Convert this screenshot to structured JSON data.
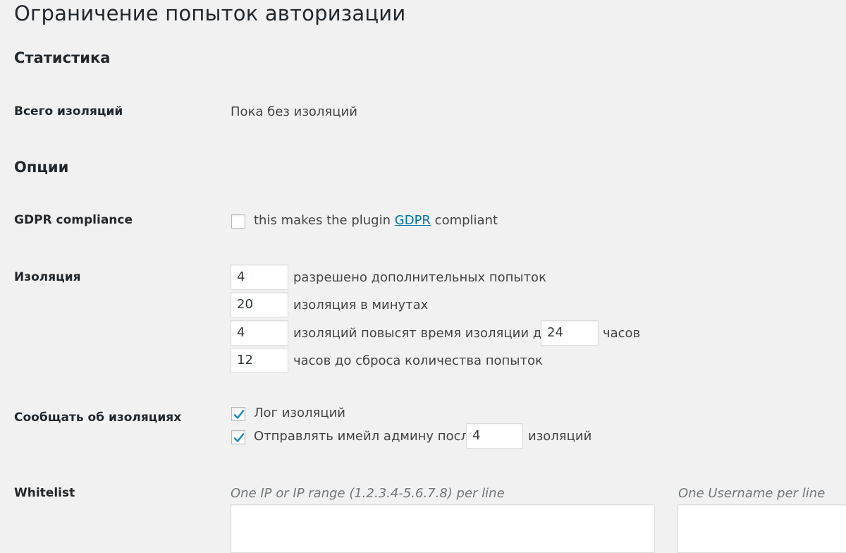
{
  "page": {
    "title": "Ограничение попыток авторизации"
  },
  "statistics": {
    "heading": "Статистика",
    "total_label": "Всего изоляций",
    "total_value": "Пока без изоляций"
  },
  "options": {
    "heading": "Опции",
    "gdpr": {
      "label": "GDPR compliance",
      "checked": false,
      "text_before": "this makes the plugin",
      "link_text": "GDPR",
      "text_after": "compliant"
    },
    "lockout": {
      "label": "Изоляция",
      "allowed_retries": {
        "value": "4",
        "suffix": "разрешено дополнительных попыток"
      },
      "lockout_duration": {
        "value": "20",
        "suffix": "изоляция в минутах"
      },
      "allowed_lockouts": {
        "value": "4",
        "middle": "изоляций повысят время изоляции до",
        "long_duration": "24",
        "suffix": "часов"
      },
      "valid_duration": {
        "value": "12",
        "suffix": "часов до сброса количества попыток"
      }
    },
    "notify": {
      "label": "Сообщать об изоляциях",
      "log": {
        "checked": true,
        "text": "Лог изоляций"
      },
      "email": {
        "checked": true,
        "text_before": "Отправлять имейл админу после",
        "value": "4",
        "text_after": "изоляций"
      }
    },
    "whitelist": {
      "label": "Whitelist",
      "ip_hint": "One IP or IP range (1.2.3.4-5.6.7.8) per line",
      "username_hint": "One Username per line",
      "ip_value": "",
      "username_value": ""
    }
  },
  "colors": {
    "background": "#f1f1f1",
    "link": "#0073aa",
    "check": "#1e8cbe"
  }
}
